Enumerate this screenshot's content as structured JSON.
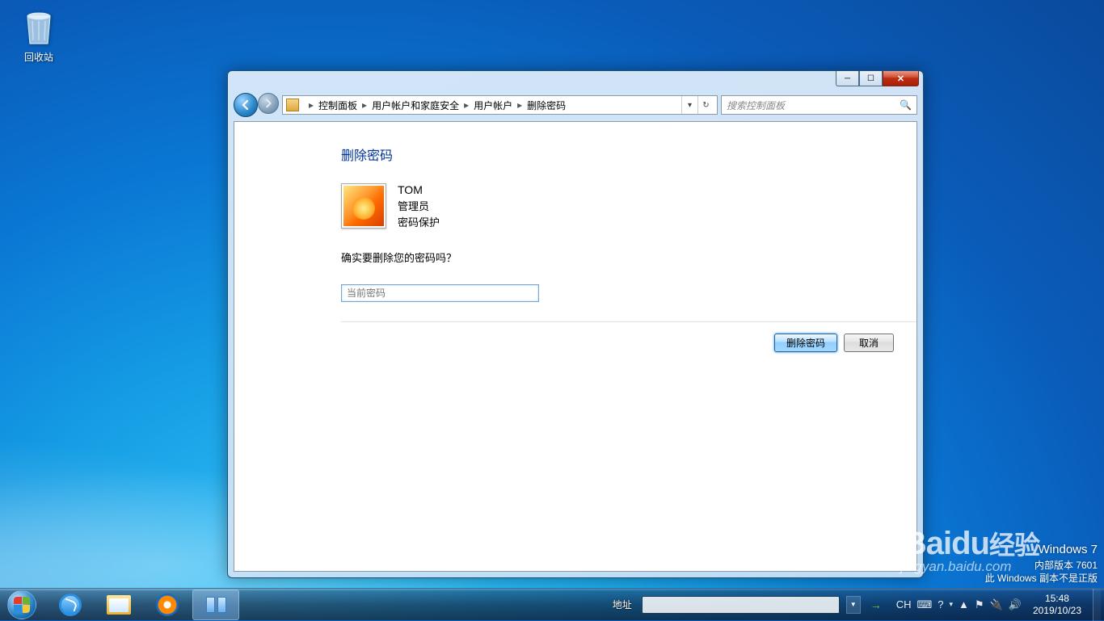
{
  "desktop": {
    "recycle_bin": "回收站"
  },
  "window": {
    "breadcrumb": {
      "root_icon": "control-panel-icon",
      "items": [
        "控制面板",
        "用户帐户和家庭安全",
        "用户帐户",
        "删除密码"
      ]
    },
    "search_placeholder": "搜索控制面板",
    "content": {
      "heading": "删除密码",
      "user": {
        "name": "TOM",
        "role": "管理员",
        "protection": "密码保护"
      },
      "prompt": "确实要删除您的密码吗？",
      "password_placeholder": "当前密码"
    },
    "buttons": {
      "primary": "删除密码",
      "secondary": "取消"
    }
  },
  "watermark": {
    "line1": "Windows 7",
    "line2": "内部版本 7601",
    "line3": "此 Windows 副本不是正版",
    "baidu_logo": "Bai",
    "baidu_du": "du",
    "baidu_cn": "经验",
    "baidu_url": "jingyan.baidu.com"
  },
  "taskbar": {
    "address_label": "地址",
    "ime": "CH",
    "tray_collapse": "▲",
    "clock": {
      "time": "15:48",
      "date": "2019/10/23"
    }
  }
}
